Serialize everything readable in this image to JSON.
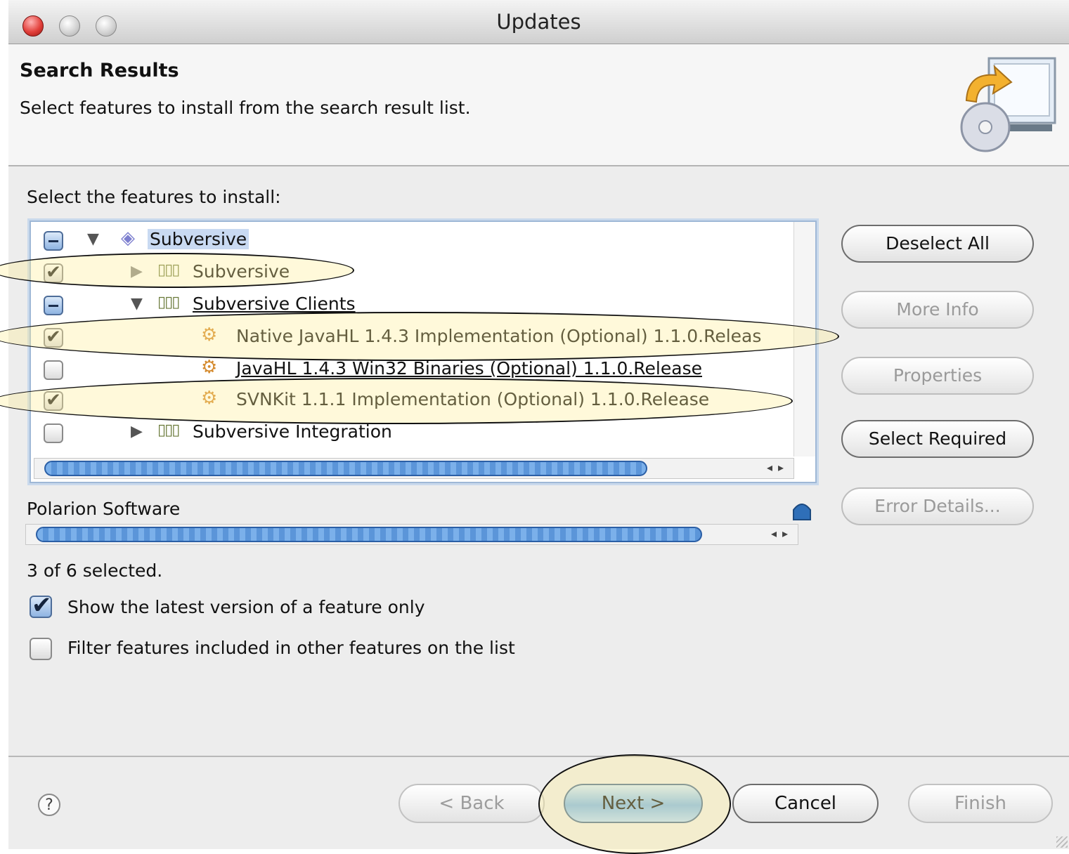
{
  "window": {
    "title": "Updates"
  },
  "header": {
    "title": "Search Results",
    "description": "Select features to install from the search result list."
  },
  "section_label": "Select the features to install:",
  "tree": {
    "rows": [
      {
        "label": "Subversive",
        "state": "mixed",
        "disclosure": "expanded",
        "icon": "plugin-icon"
      },
      {
        "label": "Subversive",
        "state": "checked",
        "disclosure": "collapsed",
        "icon": "feature-icon"
      },
      {
        "label": "Subversive Clients",
        "state": "mixed",
        "disclosure": "expanded",
        "icon": "feature-icon"
      },
      {
        "label": "Native JavaHL 1.4.3 Implementation (Optional) 1.1.0.Releas",
        "state": "checked",
        "icon": "component-icon"
      },
      {
        "label": "JavaHL 1.4.3 Win32 Binaries (Optional) 1.1.0.Release",
        "state": "unchecked",
        "icon": "component-icon"
      },
      {
        "label": "SVNKit 1.1.1 Implementation (Optional) 1.1.0.Release",
        "state": "checked",
        "icon": "component-icon"
      },
      {
        "label": "Subversive Integration",
        "state": "unchecked",
        "disclosure": "collapsed",
        "icon": "feature-icon"
      }
    ]
  },
  "provider_label": "Polarion Software",
  "selection_status": "3 of 6 selected.",
  "options": {
    "latest_only": {
      "label": "Show the latest version of a feature only",
      "checked": true
    },
    "filter_included": {
      "label": "Filter features included in other features on the list",
      "checked": false
    }
  },
  "side_buttons": {
    "deselect_all": "Deselect All",
    "more_info": "More Info",
    "properties": "Properties",
    "select_required": "Select Required",
    "error_details": "Error Details..."
  },
  "footer": {
    "back": "< Back",
    "next": "Next >",
    "cancel": "Cancel",
    "finish": "Finish",
    "help": "?"
  },
  "colors": {
    "highlight": "#fff0a0",
    "scroll_thumb": "#5b95d9",
    "default_button": "#7db7ee"
  }
}
